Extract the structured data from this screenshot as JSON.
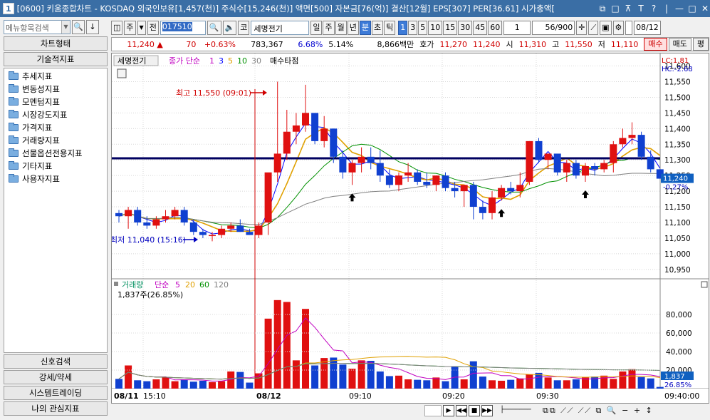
{
  "window": {
    "number": "1",
    "title": "[0600] 키움종합차트 - KOSDAQ 외국인보유[1,457(천)] 주식수[15,246(천)] 액면[500] 자본금[76(억)] 결산[12월] EPS[307] PER[36.61] 시가총액[",
    "controls": [
      "⧉",
      "□",
      "⊼",
      "T",
      "?",
      "|",
      "—",
      "□",
      "✕"
    ]
  },
  "left": {
    "search_placeholder": "메뉴항목검색",
    "top_buttons": [
      "차트형태",
      "기술적지표"
    ],
    "tree": [
      "추세지표",
      "변동성지표",
      "모멘텀지표",
      "시장강도지표",
      "가격지표",
      "거래량지표",
      "선물옵션전용지표",
      "기타지표",
      "사용자지표"
    ],
    "bottom_buttons": [
      "신호검색",
      "강세/약세",
      "시스템트레이딩",
      "나의 관심지표"
    ]
  },
  "toolbar": {
    "type": "주",
    "prefix": "전",
    "code": "017510",
    "market": "코",
    "name": "세명전기",
    "periods": [
      "일",
      "주",
      "월",
      "년",
      "분",
      "초",
      "틱"
    ],
    "active_period": "분",
    "intervals": [
      "1",
      "3",
      "5",
      "10",
      "15",
      "30",
      "45",
      "60"
    ],
    "active_interval": "1",
    "unit_value": "1",
    "count": "56/900",
    "date": "08/12"
  },
  "info": {
    "price": "11,240",
    "arrow": "▲",
    "change": "70",
    "change_pct": "+0.63%",
    "volume": "783,367",
    "rate1": "6.68%",
    "rate2": "5.14%",
    "amount": "8,866백만",
    "quote_label": "호가",
    "ask": "11,270",
    "bid": "11,240",
    "open_label": "시",
    "open": "11,310",
    "high_label": "고",
    "high": "11,550",
    "low_label": "저",
    "low": "11,110",
    "buy": "매수",
    "sell": "매도",
    "eval": "평"
  },
  "chart_labels": {
    "stock_tag": "세명전기",
    "ma_label": "종가 단순",
    "ma_periods": [
      "1",
      "3",
      "5",
      "10",
      "30"
    ],
    "buy_signal": "매수타점",
    "high_note": "최고 11,550 (09:01)",
    "low_note": "최저 11,040 (15:16)",
    "lc": "LC:1.81",
    "hc": "HC:-2.68",
    "cur_price_tag": "11,240",
    "cur_pct_tag": "-0.27%",
    "vol_label": "거래량",
    "vol_ma_label": "단순",
    "vol_ma_periods": [
      "5",
      "20",
      "60",
      "120"
    ],
    "vol_value": "1,837주(26.85%)",
    "vol_tag": "1,837",
    "vol_pct_tag": "26.85%",
    "price_ticks": [
      "11,600",
      "11,550",
      "11,500",
      "11,450",
      "11,400",
      "11,350",
      "11,300",
      "11,250",
      "11,200",
      "11,150",
      "11,100",
      "11,050",
      "11,000",
      "10,950"
    ],
    "vol_ticks": [
      "80,000",
      "60,000",
      "40,000",
      "20,000"
    ],
    "time_ticks": [
      "08/11",
      "15:10",
      "08/12",
      "09:10",
      "09:20",
      "09:30",
      "09:40:00"
    ]
  },
  "chart_data": {
    "type": "candlestick",
    "unit": "1-minute",
    "candles": [
      [
        11130,
        11140,
        11100,
        11120
      ],
      [
        11120,
        11150,
        11080,
        11140
      ],
      [
        11140,
        11150,
        11090,
        11100
      ],
      [
        11100,
        11120,
        11080,
        11090
      ],
      [
        11090,
        11120,
        11080,
        11110
      ],
      [
        11110,
        11140,
        11100,
        11120
      ],
      [
        11120,
        11150,
        11110,
        11140
      ],
      [
        11140,
        11150,
        11090,
        11100
      ],
      [
        11100,
        11110,
        11060,
        11070
      ],
      [
        11070,
        11080,
        11050,
        11060
      ],
      [
        11060,
        11070,
        11040,
        11060
      ],
      [
        11060,
        11090,
        11050,
        11080
      ],
      [
        11080,
        11100,
        11070,
        11090
      ],
      [
        11090,
        11110,
        11070,
        11070
      ],
      [
        11070,
        11080,
        11060,
        11060
      ],
      [
        11060,
        11100,
        11050,
        11090
      ],
      [
        11100,
        11250,
        11060,
        11260
      ],
      [
        11260,
        11550,
        11230,
        11320
      ],
      [
        11320,
        11460,
        11300,
        11390
      ],
      [
        11390,
        11450,
        11350,
        11410
      ],
      [
        11410,
        11540,
        11390,
        11450
      ],
      [
        11450,
        11420,
        11350,
        11360
      ],
      [
        11360,
        11440,
        11340,
        11400
      ],
      [
        11400,
        11400,
        11290,
        11310
      ],
      [
        11310,
        11330,
        11240,
        11260
      ],
      [
        11260,
        11300,
        11220,
        11290
      ],
      [
        11290,
        11340,
        11260,
        11310
      ],
      [
        11310,
        11340,
        11270,
        11290
      ],
      [
        11290,
        11330,
        11230,
        11250
      ],
      [
        11250,
        11270,
        11210,
        11220
      ],
      [
        11220,
        11260,
        11200,
        11250
      ],
      [
        11250,
        11290,
        11230,
        11260
      ],
      [
        11260,
        11270,
        11220,
        11230
      ],
      [
        11230,
        11260,
        11210,
        11220
      ],
      [
        11220,
        11250,
        11200,
        11250
      ],
      [
        11250,
        11260,
        11200,
        11210
      ],
      [
        11210,
        11230,
        11180,
        11200
      ],
      [
        11200,
        11220,
        11150,
        11220
      ],
      [
        11220,
        11230,
        11110,
        11150
      ],
      [
        11150,
        11170,
        11110,
        11130
      ],
      [
        11130,
        11200,
        11110,
        11180
      ],
      [
        11180,
        11220,
        11170,
        11210
      ],
      [
        11210,
        11230,
        11190,
        11200
      ],
      [
        11200,
        11260,
        11180,
        11220
      ],
      [
        11230,
        11360,
        11220,
        11360
      ],
      [
        11360,
        11370,
        11290,
        11300
      ],
      [
        11300,
        11320,
        11270,
        11320
      ],
      [
        11320,
        11310,
        11250,
        11260
      ],
      [
        11260,
        11300,
        11230,
        11290
      ],
      [
        11290,
        11300,
        11240,
        11250
      ],
      [
        11250,
        11290,
        11230,
        11280
      ],
      [
        11280,
        11290,
        11250,
        11270
      ],
      [
        11270,
        11300,
        11260,
        11290
      ],
      [
        11290,
        11360,
        11260,
        11350
      ],
      [
        11350,
        11400,
        11340,
        11370
      ],
      [
        11370,
        11420,
        11350,
        11380
      ],
      [
        11380,
        11390,
        11300,
        11310
      ],
      [
        11310,
        11330,
        11260,
        11270
      ],
      [
        11270,
        11270,
        11240,
        11240
      ]
    ],
    "volume": [
      10500,
      25000,
      9000,
      8000,
      10000,
      12000,
      8000,
      10000,
      7500,
      8500,
      7000,
      8000,
      18500,
      18000,
      6500,
      16500,
      75500,
      95500,
      93500,
      30500,
      86000,
      25000,
      33000,
      33500,
      26000,
      21500,
      30500,
      30000,
      18500,
      13500,
      14000,
      10000,
      9500,
      9000,
      12000,
      8000,
      23500,
      10000,
      29500,
      13000,
      9000,
      8500,
      9500,
      11000,
      15500,
      17000,
      12000,
      9000,
      9000,
      10000,
      12000,
      13000,
      14000,
      10500,
      18500,
      21000,
      12500,
      11000,
      1837
    ],
    "hline": 11305,
    "y_range": [
      10920,
      11640
    ],
    "vol_range": [
      0,
      100000
    ]
  }
}
